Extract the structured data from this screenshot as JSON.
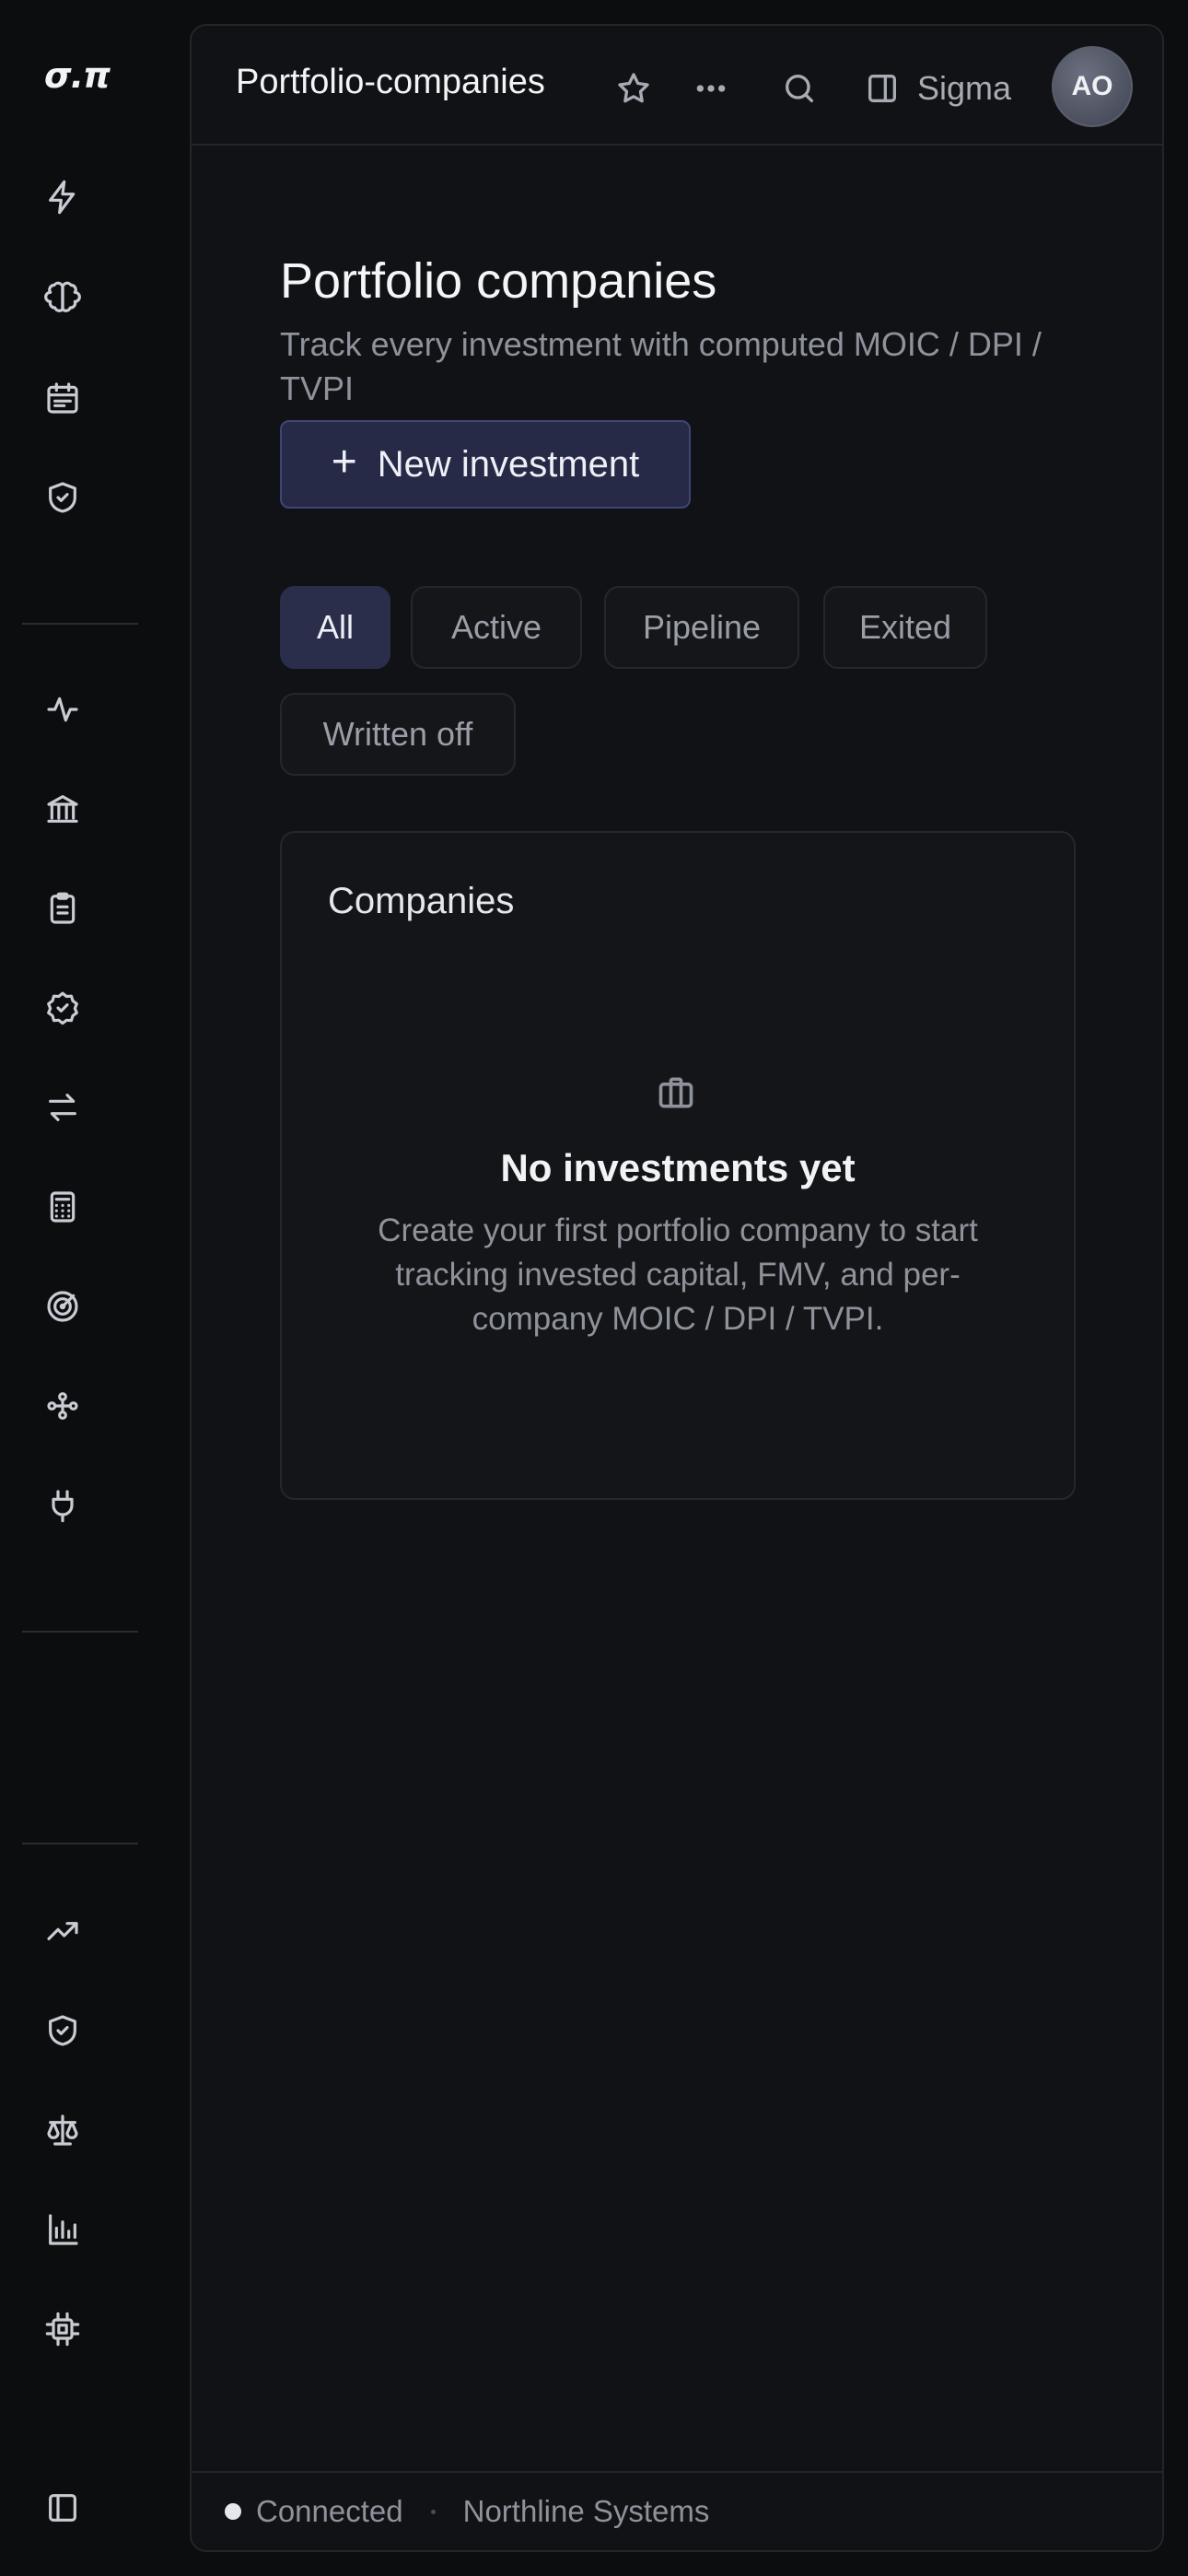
{
  "app": {
    "logo": "σ.π"
  },
  "rail": {
    "top_icons": [
      "lightning-icon",
      "brain-icon",
      "calendar-icon",
      "shield-check-icon"
    ],
    "middle_icons": [
      "activity-icon",
      "bank-icon",
      "clipboard-icon",
      "badge-check-icon",
      "arrows-swap-icon",
      "calculator-icon",
      "target-icon",
      "workflow-icon",
      "plug-icon"
    ],
    "bottom_icons": [
      "trending-up-icon",
      "shield-check-icon",
      "scale-icon",
      "bar-chart-icon",
      "chip-icon"
    ],
    "footer_icon": "panel-toggle-icon"
  },
  "header": {
    "title": "Portfolio-companies",
    "workspace": "Sigma",
    "avatar_initials": "AO"
  },
  "page": {
    "title": "Portfolio companies",
    "subtitle": "Track every investment with computed MOIC / DPI / TVPI",
    "primary_action": "New investment"
  },
  "filters": [
    {
      "label": "All",
      "active": true
    },
    {
      "label": "Active",
      "active": false
    },
    {
      "label": "Pipeline",
      "active": false
    },
    {
      "label": "Exited",
      "active": false
    },
    {
      "label": "Written off",
      "active": false
    }
  ],
  "companies_card": {
    "title": "Companies",
    "empty_title": "No investments yet",
    "empty_text": "Create your first portfolio company to start tracking invested capital, FMV, and per-company MOIC / DPI / TVPI."
  },
  "status": {
    "connection": "Connected",
    "organization": "Northline Systems"
  }
}
